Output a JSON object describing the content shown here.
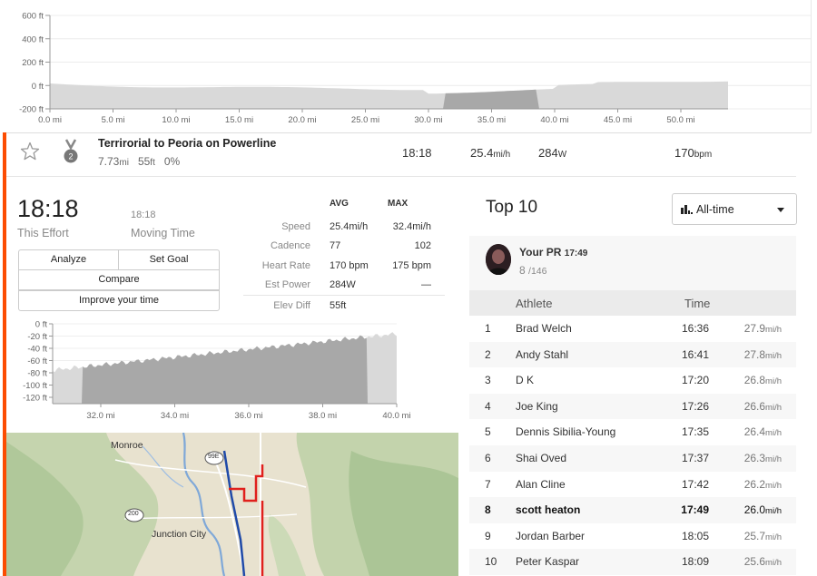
{
  "top_profile": {
    "y_ticks": [
      "600 ft",
      "400 ft",
      "200 ft",
      "0 ft",
      "-200 ft"
    ],
    "x_ticks": [
      "0.0 mi",
      "5.0 mi",
      "10.0 mi",
      "15.0 mi",
      "20.0 mi",
      "25.0 mi",
      "30.0 mi",
      "35.0 mi",
      "40.0 mi",
      "45.0 mi",
      "50.0 mi"
    ]
  },
  "segment": {
    "name": "Terrirorial to Peoria on Powerline",
    "distance": "7.73",
    "distance_unit": "mi",
    "elev": "55",
    "elev_unit": "ft",
    "grade": "0%",
    "time": "18:18",
    "speed": "25.4",
    "speed_unit": "mi/h",
    "power": "284",
    "power_unit": "W",
    "hr": "170",
    "hr_unit": "bpm",
    "medal_rank": "2"
  },
  "effort": {
    "time": "18:18",
    "time_label": "This Effort",
    "moving_time": "18:18",
    "moving_label": "Moving Time",
    "buttons": {
      "analyze": "Analyze",
      "set_goal": "Set Goal",
      "compare": "Compare",
      "improve": "Improve your time"
    }
  },
  "stats": {
    "avg_header": "AVG",
    "max_header": "MAX",
    "rows": [
      {
        "label": "Speed",
        "avg": "25.4mi/h",
        "max": "32.4mi/h"
      },
      {
        "label": "Cadence",
        "avg": "77",
        "max": "102"
      },
      {
        "label": "Heart Rate",
        "avg": "170 bpm",
        "max": "175 bpm"
      },
      {
        "label": "Est Power",
        "avg": "284W",
        "max": "—"
      },
      {
        "label": "Elev Diff",
        "avg": "55ft",
        "max": ""
      }
    ]
  },
  "effort_profile": {
    "y_ticks": [
      "0 ft",
      "-20 ft",
      "-40 ft",
      "-60 ft",
      "-80 ft",
      "-100 ft",
      "-120 ft"
    ],
    "x_ticks": [
      "32.0 mi",
      "34.0 mi",
      "36.0 mi",
      "38.0 mi",
      "40.0 mi"
    ]
  },
  "map": {
    "labels": {
      "monroe": "Monroe",
      "junction_city": "Junction City",
      "highway_99e": "99E",
      "highway_200": "200"
    }
  },
  "leaderboard": {
    "title": "Top 10",
    "filter": "All-time",
    "pr_label": "Your PR",
    "pr_time": "17:49",
    "pr_rank": "8",
    "pr_total": "/146",
    "col_athlete": "Athlete",
    "col_time": "Time",
    "rows": [
      {
        "rank": "1",
        "name": "Brad Welch",
        "time": "16:36",
        "speed": "27.9",
        "unit": "mi/h"
      },
      {
        "rank": "2",
        "name": "Andy Stahl",
        "time": "16:41",
        "speed": "27.8",
        "unit": "mi/h"
      },
      {
        "rank": "3",
        "name": "D K",
        "time": "17:20",
        "speed": "26.8",
        "unit": "mi/h"
      },
      {
        "rank": "4",
        "name": "Joe King",
        "time": "17:26",
        "speed": "26.6",
        "unit": "mi/h"
      },
      {
        "rank": "5",
        "name": "Dennis Sibilia-Young",
        "time": "17:35",
        "speed": "26.4",
        "unit": "mi/h"
      },
      {
        "rank": "6",
        "name": "Shai Oved",
        "time": "17:37",
        "speed": "26.3",
        "unit": "mi/h"
      },
      {
        "rank": "7",
        "name": "Alan Cline",
        "time": "17:42",
        "speed": "26.2",
        "unit": "mi/h"
      },
      {
        "rank": "8",
        "name": "scott heaton",
        "time": "17:49",
        "speed": "26.0",
        "unit": "mi/h"
      },
      {
        "rank": "9",
        "name": "Jordan Barber",
        "time": "18:05",
        "speed": "25.7",
        "unit": "mi/h"
      },
      {
        "rank": "10",
        "name": "Peter Kaspar",
        "time": "18:09",
        "speed": "25.6",
        "unit": "mi/h"
      }
    ]
  },
  "colors": {
    "accent": "#fc4c02",
    "profile_fill": "#d9d9d9",
    "profile_highlight": "#a8a8a8",
    "route_blue": "#1f4aa8",
    "route_red": "#e0201c"
  }
}
